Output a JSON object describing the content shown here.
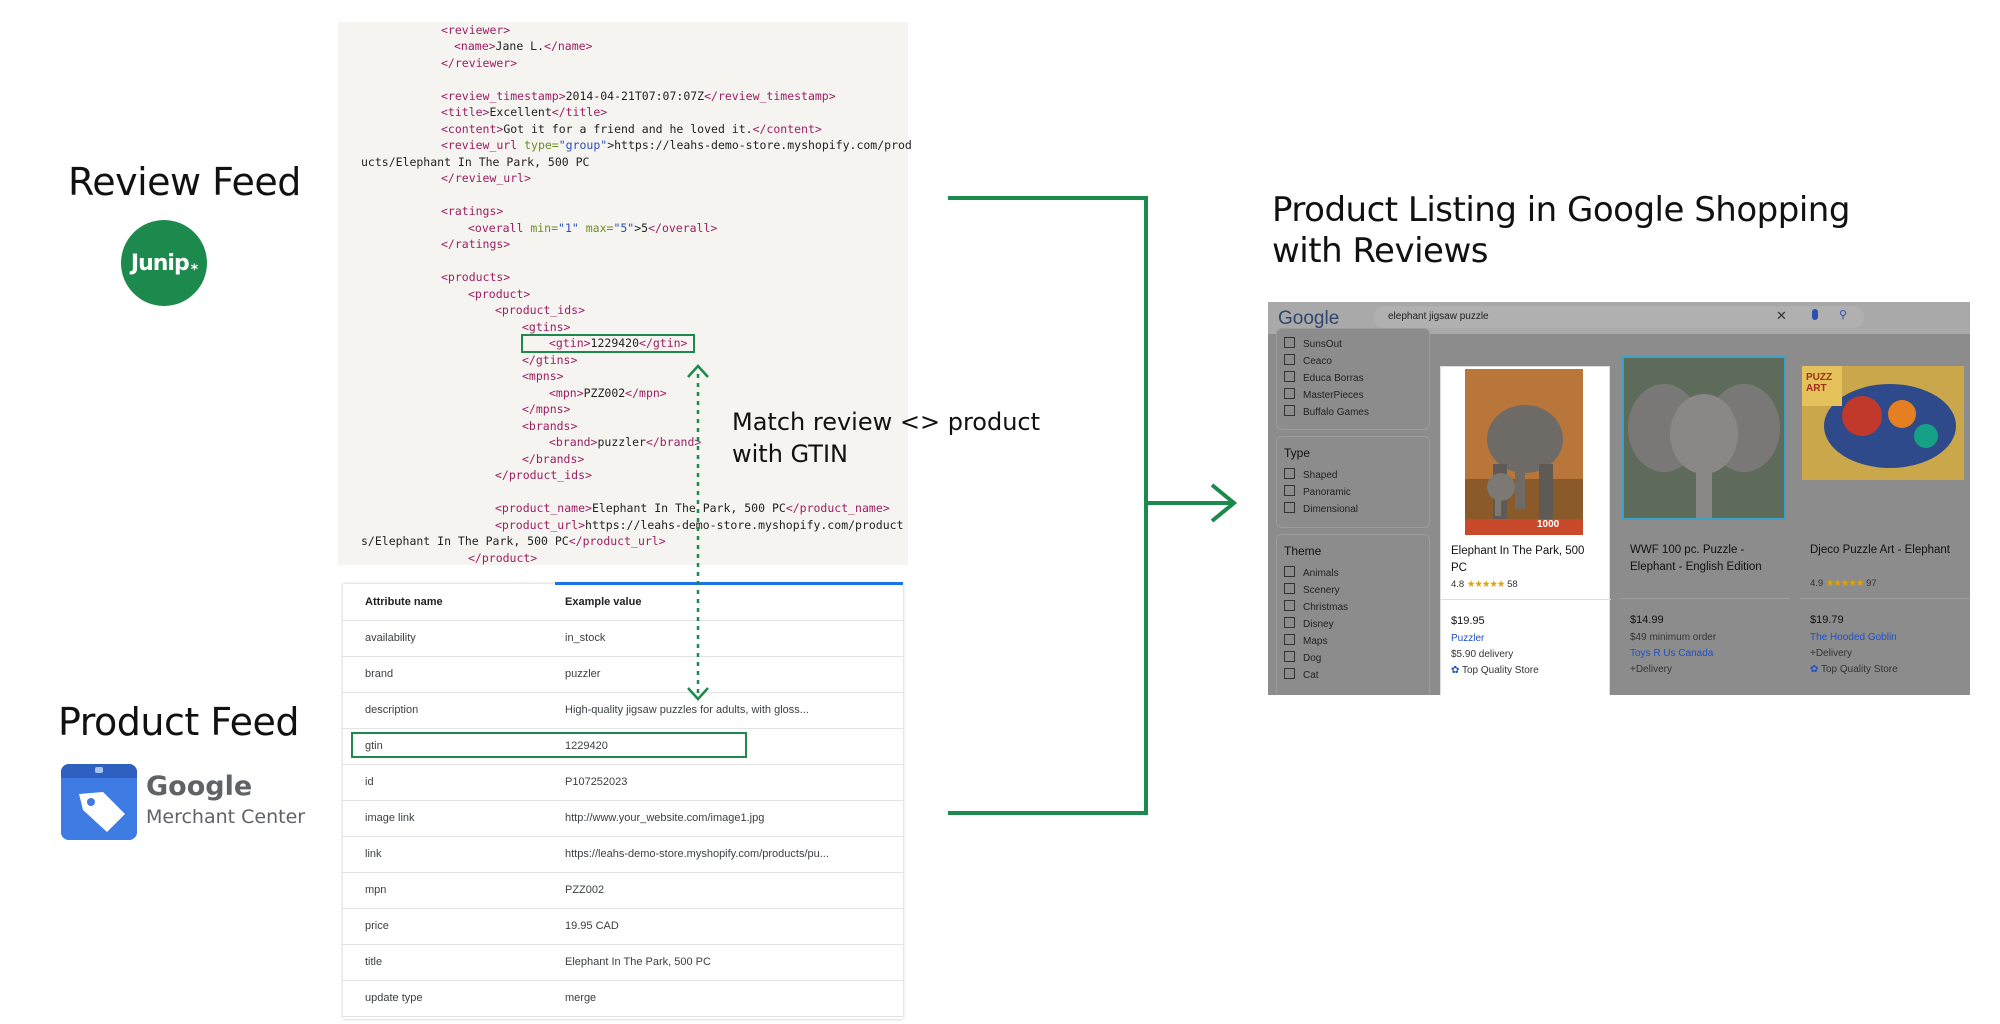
{
  "review_feed": {
    "title": "Review Feed",
    "logo_text": "Junip",
    "logo_mark": "*"
  },
  "product_feed": {
    "title": "Product Feed",
    "logo_google": "Google",
    "logo_mc": "Merchant Center"
  },
  "xml": {
    "reviewer_open": "<reviewer>",
    "name_open": "<name>",
    "name_value": "Jane L.",
    "name_close": "</name>",
    "reviewer_close": "</reviewer>",
    "ts_open": "<review_timestamp>",
    "ts_value": "2014-04-21T07:07:07Z",
    "ts_close": "</review_timestamp>",
    "title_open": "<title>",
    "title_value": "Excellent",
    "title_close": "</title>",
    "content_open": "<content>",
    "content_value": "Got it for a friend and he loved it.",
    "content_close": "</content>",
    "review_url_open": "<review_url",
    "type_attr": "type=",
    "type_val": "\"group\"",
    "review_url_value_a": ">https://leahs-demo-store.myshopify.com/prod",
    "review_url_value_b": "ucts/Elephant In The Park, 500 PC",
    "review_url_close": "</review_url>",
    "ratings_open": "<ratings>",
    "overall_open": "<overall",
    "min_attr": "min=",
    "min_val": "\"1\"",
    "max_attr": "max=",
    "max_val": "\"5\"",
    "overall_value": ">5",
    "overall_close": "</overall>",
    "ratings_close": "</ratings>",
    "products_open": "<products>",
    "product_open": "<product>",
    "product_ids_open": "<product_ids>",
    "gtins_open": "<gtins>",
    "gtin_open": "<gtin>",
    "gtin_value": "1229420",
    "gtin_close": "</gtin>",
    "gtins_close": "</gtins>",
    "mpns_open": "<mpns>",
    "mpn_open": "<mpn>",
    "mpn_value": "PZZ002",
    "mpn_close": "</mpn>",
    "mpns_close": "</mpns>",
    "brands_open": "<brands>",
    "brand_open": "<brand>",
    "brand_value": "puzzler",
    "brand_close": "</brand>",
    "brands_close": "</brands>",
    "product_ids_close": "</product_ids>",
    "pname_open": "<product_name>",
    "pname_value": "Elephant In The Park, 500 PC",
    "pname_close": "</product_name>",
    "purl_open": "<product_url>",
    "purl_value_a": "https://leahs-demo-store.myshopify.com/product",
    "purl_value_b": "s/Elephant In The Park, 500 PC",
    "purl_close": "</product_url>",
    "product_close": "</product>"
  },
  "attribute_table": {
    "col_name": "Attribute name",
    "col_value": "Example value",
    "rows": [
      {
        "name": "availability",
        "value": "in_stock"
      },
      {
        "name": "brand",
        "value": "puzzler"
      },
      {
        "name": "description",
        "value": "High-quality jigsaw puzzles for adults, with gloss..."
      },
      {
        "name": "gtin",
        "value": "1229420"
      },
      {
        "name": "id",
        "value": "P107252023"
      },
      {
        "name": "image link",
        "value": "http://www.your_website.com/image1.jpg"
      },
      {
        "name": "link",
        "value": "https://leahs-demo-store.myshopify.com/products/pu..."
      },
      {
        "name": "mpn",
        "value": "PZZ002"
      },
      {
        "name": "price",
        "value": "19.95 CAD"
      },
      {
        "name": "title",
        "value": "Elephant In The Park, 500 PC"
      },
      {
        "name": "update type",
        "value": "merge"
      }
    ]
  },
  "match_note": {
    "line1": "Match review <> product",
    "line2": "with GTIN"
  },
  "right_title": {
    "line1": "Product Listing in Google Shopping",
    "line2": "with Reviews"
  },
  "shopping": {
    "logo": "Google",
    "query": "elephant jigsaw puzzle",
    "brand_filters": [
      "SunsOut",
      "Ceaco",
      "Educa Borras",
      "MasterPieces",
      "Buffalo Games"
    ],
    "type_title": "Type",
    "type_filters": [
      "Shaped",
      "Panoramic",
      "Dimensional"
    ],
    "theme_title": "Theme",
    "theme_filters": [
      "Animals",
      "Scenery",
      "Christmas",
      "Disney",
      "Maps",
      "Dog",
      "Cat"
    ],
    "cards": [
      {
        "name": "Elephant In The Park, 500 PC",
        "rating": "4.8",
        "stars": "★★★★★",
        "count": "58",
        "price": "$19.95",
        "line1": "Puzzler",
        "line2": "$5.90 delivery",
        "line3": "Top Quality Store",
        "img_text": "1000"
      },
      {
        "name": "WWF 100 pc. Puzzle - Elephant - English Edition",
        "rating": "",
        "stars": "",
        "count": "",
        "price": "$14.99",
        "line1": "$49 minimum order",
        "line2": "Toys R Us Canada",
        "line3": "+Delivery"
      },
      {
        "name": "Djeco Puzzle Art - Elephant",
        "rating": "4.9",
        "stars": "★★★★★",
        "count": "97",
        "price": "$19.79",
        "line1": "The Hooded Goblin",
        "line2": "+Delivery",
        "line3": "Top Quality Store",
        "img_text": "PUZZ ART"
      }
    ]
  },
  "colors": {
    "accent_green": "#1c8a4d",
    "google_blue": "#1a73e8"
  }
}
